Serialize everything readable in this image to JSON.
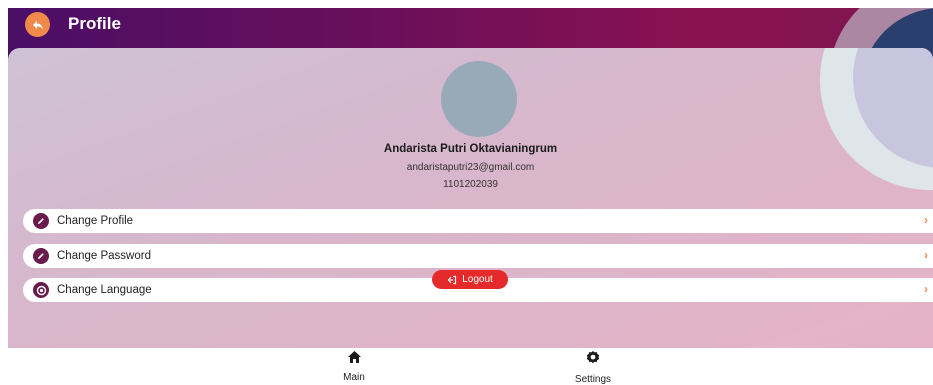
{
  "app_bar": {
    "title": "Profile"
  },
  "profile": {
    "name": "Andarista Putri Oktavianingrum",
    "email": "andaristaputri23@gmail.com",
    "id_number": "1101202039"
  },
  "menu": [
    {
      "label": "Change Profile",
      "icon": "pencil-icon"
    },
    {
      "label": "Change Password",
      "icon": "pencil-icon"
    },
    {
      "label": "Change Language",
      "icon": "globe-icon"
    }
  ],
  "logout": {
    "label": "Logout",
    "icon": "logout-icon"
  },
  "bottom_nav": [
    {
      "label": "Main",
      "icon": "home-icon"
    },
    {
      "label": "Settings",
      "icon": "gear-icon"
    }
  ],
  "colors": {
    "accent": "#f08a4b",
    "header_start": "#4a0e66",
    "header_end": "#8a1152",
    "logout": "#e42a2a",
    "menu_icon": "#6a1b4d"
  }
}
